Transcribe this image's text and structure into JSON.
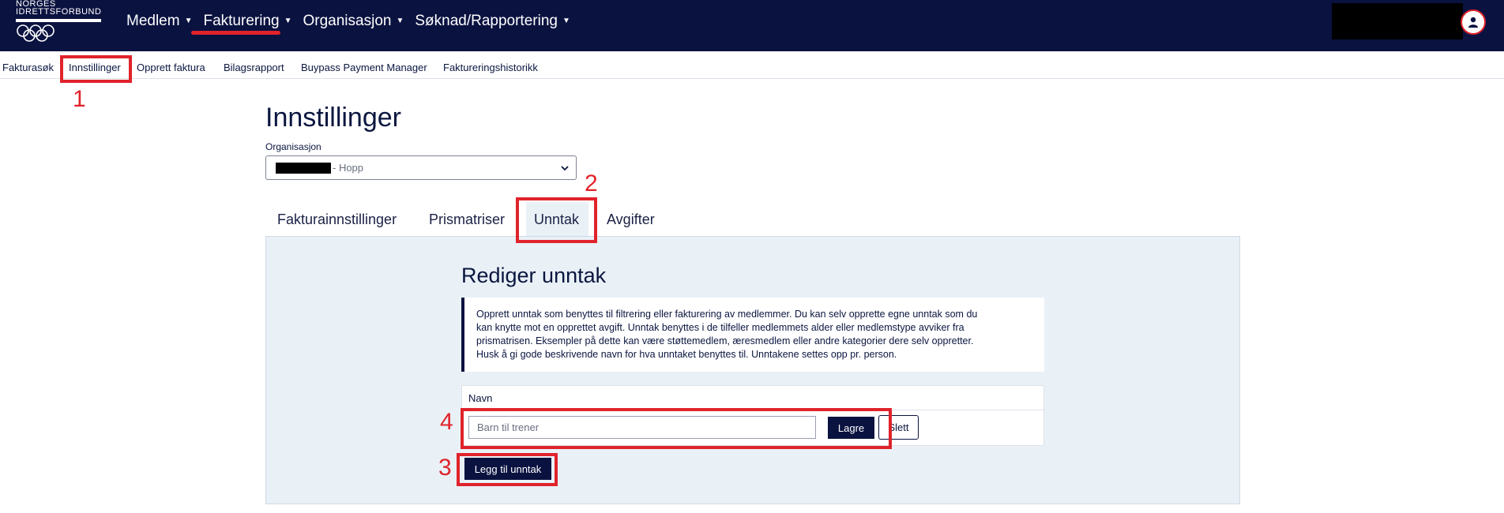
{
  "logo": {
    "line1": "NORGES",
    "line2": "IDRETTSFORBUND"
  },
  "main_nav": [
    {
      "label": "Medlem"
    },
    {
      "label": "Fakturering"
    },
    {
      "label": "Organisasjon"
    },
    {
      "label": "Søknad/Rapportering"
    }
  ],
  "sub_nav": [
    {
      "label": "Fakturasøk"
    },
    {
      "label": "Innstillinger"
    },
    {
      "label": "Opprett faktura"
    },
    {
      "label": "Bilagsrapport"
    },
    {
      "label": "Buypass Payment Manager"
    },
    {
      "label": "Faktureringshistorikk"
    }
  ],
  "page": {
    "title": "Innstillinger",
    "org_label": "Organisasjon",
    "org_value": "- Hopp"
  },
  "tabs": [
    {
      "label": "Fakturainnstillinger"
    },
    {
      "label": "Prismatriser"
    },
    {
      "label": "Unntak"
    },
    {
      "label": "Avgifter"
    }
  ],
  "section": {
    "title": "Rediger unntak",
    "info_lines": [
      "Opprett unntak som benyttes til filtrering eller fakturering av medlemmer. Du kan selv opprette egne unntak som du",
      "kan knytte mot en opprettet avgift. Unntak benyttes i de tilfeller medlemmets alder eller medlemstype avviker fra",
      "prismatrisen. Eksempler på dette kan være støttemedlem, æresmedlem eller andre kategorier dere selv oppretter.",
      "Husk å gi gode beskrivende navn for hva unntaket benyttes til. Unntakene settes opp pr. person."
    ],
    "table_header": "Navn",
    "input_placeholder": "Barn til trener",
    "save_label": "Lagre",
    "delete_label": "Slett",
    "add_label": "Legg til unntak"
  },
  "annotations": [
    "1",
    "2",
    "3",
    "4"
  ],
  "colors": {
    "navy": "#0a1240",
    "annotation_red": "#e0232b",
    "panel_bg": "#e9f1f7"
  }
}
